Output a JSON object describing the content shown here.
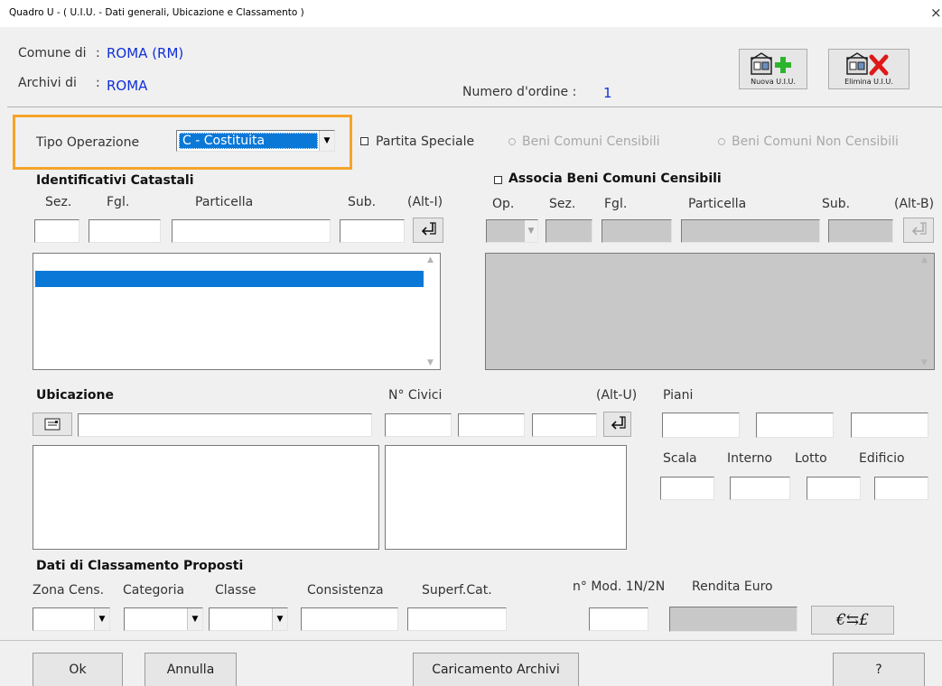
{
  "window": {
    "title": "Quadro U - ( U.I.U. - Dati generali, Ubicazione e Classamento )",
    "close": "×"
  },
  "header": {
    "comune_label": "Comune di",
    "comune_value": "ROMA (RM)",
    "archivi_label": "Archivi di",
    "archivi_value": "ROMA",
    "sep": ":",
    "numero_label": "Numero d'ordine :",
    "numero_value": "1",
    "nuova_label": "Nuova U.I.U.",
    "elimina_label": "Elimina U.I.U."
  },
  "operazione": {
    "label": "Tipo Operazione",
    "value": "C - Costituita",
    "partita_speciale": "Partita Speciale",
    "beni_censibili": "Beni Comuni Censibili",
    "beni_non_censibili": "Beni Comuni Non Censibili"
  },
  "identificativi": {
    "title": "Identificativi Catastali",
    "sez": "Sez.",
    "fgl": "Fgl.",
    "particella": "Particella",
    "sub": "Sub.",
    "shortcut": "(Alt-I)"
  },
  "associa": {
    "title": "Associa Beni Comuni Censibili",
    "op": "Op.",
    "sez": "Sez.",
    "fgl": "Fgl.",
    "particella": "Particella",
    "sub": "Sub.",
    "shortcut": "(Alt-B)"
  },
  "ubicazione": {
    "title": "Ubicazione",
    "civici": "N° Civici",
    "shortcut": "(Alt-U)",
    "piani": "Piani",
    "scala": "Scala",
    "interno": "Interno",
    "lotto": "Lotto",
    "edificio": "Edificio"
  },
  "classamento": {
    "title": "Dati di Classamento Proposti",
    "zona": "Zona Cens.",
    "categoria": "Categoria",
    "classe": "Classe",
    "consistenza": "Consistenza",
    "superf": "Superf.Cat.",
    "mod": "n° Mod. 1N/2N",
    "rendita": "Rendita  Euro",
    "currency": "€⇆£"
  },
  "footer": {
    "ok": "Ok",
    "annulla": "Annulla",
    "caricamento": "Caricamento Archivi",
    "help": "?"
  },
  "colors": {
    "accent_orange": "#f5a42a",
    "selection_blue": "#0a78d7",
    "value_blue": "#1030d8",
    "disabled_grey": "#c8c8c8"
  }
}
